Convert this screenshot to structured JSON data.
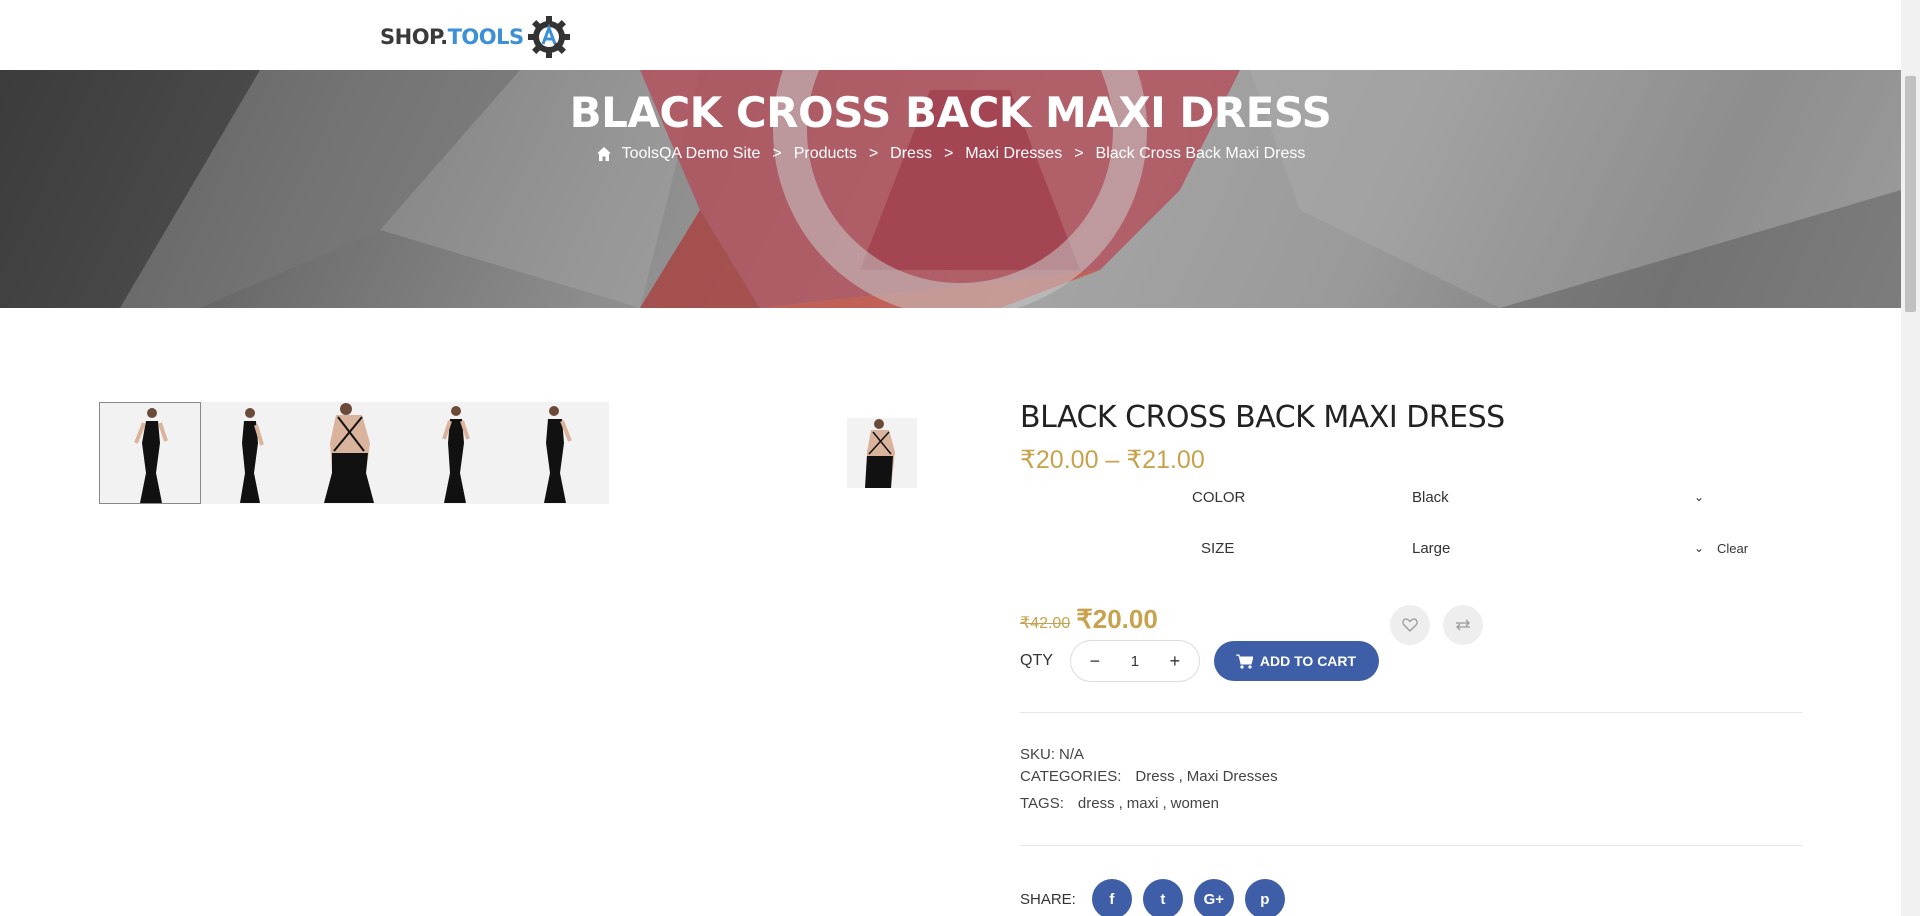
{
  "logo": {
    "shop": "SHOP.",
    "tools": "TOOLS"
  },
  "banner": {
    "title": "BLACK CROSS BACK MAXI DRESS",
    "breadcrumb": [
      "ToolsQA Demo Site",
      "Products",
      "Dress",
      "Maxi Dresses",
      "Black Cross Back Maxi Dress"
    ],
    "separator": ">"
  },
  "product": {
    "title": "BLACK CROSS BACK MAXI DRESS",
    "price_range": "₹20.00 – ₹21.00",
    "color_label": "COLOR",
    "color_value": "Black",
    "size_label": "SIZE",
    "size_value": "Large",
    "clear_label": "Clear",
    "old_price": "₹42.00",
    "new_price": "₹20.00",
    "qty_label": "QTY",
    "qty_value": "1",
    "qty_minus": "−",
    "qty_plus": "+",
    "add_to_cart": "ADD TO CART",
    "sku_label": "SKU:",
    "sku_value": "N/A",
    "categories_label": "CATEGORIES:",
    "categories": [
      "Dress",
      "Maxi Dresses"
    ],
    "tags_label": "TAGS:",
    "tags": [
      "dress",
      "maxi",
      "women"
    ],
    "share_label": "SHARE:",
    "share_icons": [
      "f",
      "t",
      "G+",
      "p"
    ]
  },
  "colors": {
    "accent": "#3f5ea8",
    "price": "#c8a24c",
    "logo_blue": "#3d8fd6"
  },
  "icons": [
    "home-icon",
    "heart-icon",
    "compare-icon",
    "cart-icon",
    "facebook-icon",
    "twitter-icon",
    "google-plus-icon",
    "pinterest-icon",
    "gear-logo-icon",
    "chevron-down-icon"
  ]
}
